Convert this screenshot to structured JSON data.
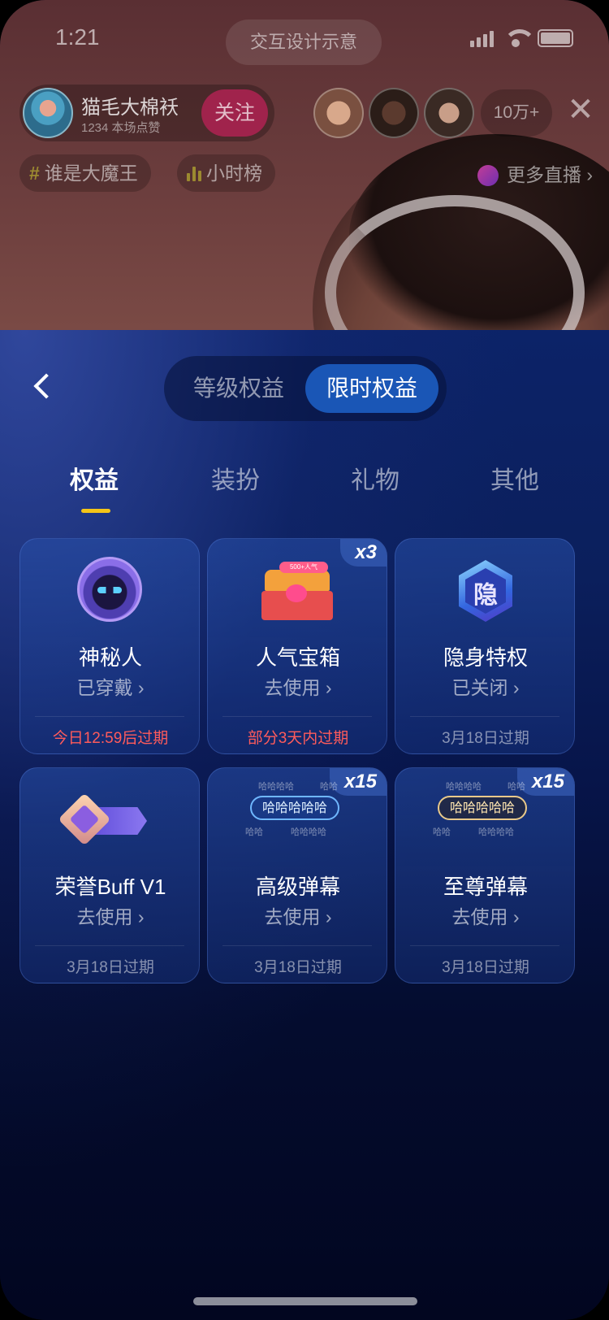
{
  "status_bar": {
    "time": "1:21",
    "design_label": "交互设计示意"
  },
  "host": {
    "name": "猫毛大棉袄",
    "likes": "1234 本场点赞",
    "follow_label": "关注"
  },
  "viewer_count": "10万+",
  "close_label": "✕",
  "tags": [
    {
      "icon": "#",
      "label": "谁是大魔王"
    },
    {
      "label": "小时榜"
    }
  ],
  "more_live": "更多直播 ›",
  "segment": {
    "options": [
      "等级权益",
      "限时权益"
    ],
    "selected": "限时权益"
  },
  "tabs": [
    {
      "label": "权益",
      "active": true
    },
    {
      "label": "装扮",
      "active": false
    },
    {
      "label": "礼物",
      "active": false
    },
    {
      "label": "其他",
      "active": false
    }
  ],
  "cards": [
    {
      "title": "神秘人",
      "action": "已穿戴 ›",
      "expire": "今日12:59后过期",
      "warn": true,
      "badge": ""
    },
    {
      "title": "人气宝箱",
      "action": "去使用 ›",
      "expire": "部分3天内过期",
      "warn": true,
      "badge": "x3",
      "icon_text": "500+人气"
    },
    {
      "title": "隐身特权",
      "action": "已关闭 ›",
      "expire": "3月18日过期",
      "warn": false,
      "badge": "",
      "icon_text": "隐"
    },
    {
      "title": "荣誉Buff V1",
      "action": "去使用 ›",
      "expire": "3月18日过期",
      "warn": false,
      "badge": ""
    },
    {
      "title": "高级弹幕",
      "action": "去使用 ›",
      "expire": "3月18日过期",
      "warn": false,
      "badge": "x15",
      "chip": "哈哈哈哈哈",
      "small": [
        "哈哈哈哈",
        "哈哈",
        "哈哈",
        "哈哈哈哈"
      ]
    },
    {
      "title": "至尊弹幕",
      "action": "去使用 ›",
      "expire": "3月18日过期",
      "warn": false,
      "badge": "x15",
      "chip": "哈哈哈哈哈",
      "small": [
        "哈哈哈哈",
        "哈哈",
        "哈哈",
        "哈哈哈哈"
      ]
    }
  ],
  "colors": {
    "accent": "#1a56b6",
    "warn": "#ff5b5b",
    "tab_indicator": "#f5c518",
    "follow": "#a0234c"
  }
}
